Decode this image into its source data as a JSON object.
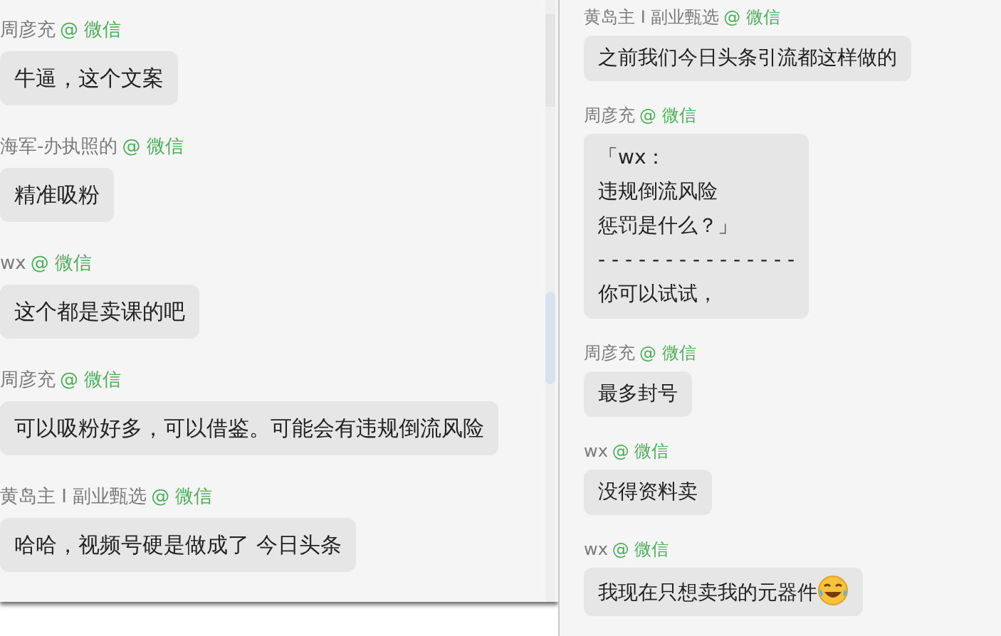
{
  "left_chat": {
    "messages": [
      {
        "sender": "周彦充",
        "source": "@ 微信",
        "text": "牛逼，这个文案"
      },
      {
        "sender": "海军-办执照的",
        "source": "@ 微信",
        "text": "精准吸粉"
      },
      {
        "sender": "wx",
        "source": "@ 微信",
        "text": "这个都是卖课的吧"
      },
      {
        "sender": "周彦充",
        "source": "@ 微信",
        "text": "可以吸粉好多，可以借鉴。可能会有违规倒流风险"
      },
      {
        "sender": "黄岛主 I 副业甄选",
        "source": "@ 微信",
        "text": "哈哈，视频号硬是做成了 今日头条"
      }
    ]
  },
  "right_chat": {
    "messages": [
      {
        "sender": "黄岛主 I 副业甄选",
        "source": "@ 微信",
        "text": "之前我们今日头条引流都这样做的",
        "emoji": false
      },
      {
        "sender": "周彦充",
        "source": "@ 微信",
        "lines": [
          "「wx：",
          "违规倒流风险",
          "惩罚是什么？」",
          "- - - - - - - - - - - - - - -",
          "你可以试试，"
        ],
        "emoji": false
      },
      {
        "sender": "周彦充",
        "source": "@ 微信",
        "text": "最多封号",
        "emoji": false
      },
      {
        "sender": "wx",
        "source": "@ 微信",
        "text": "没得资料卖",
        "emoji": false
      },
      {
        "sender": "wx",
        "source": "@ 微信",
        "text": "我现在只想卖我的元器件",
        "emoji": true
      }
    ]
  }
}
